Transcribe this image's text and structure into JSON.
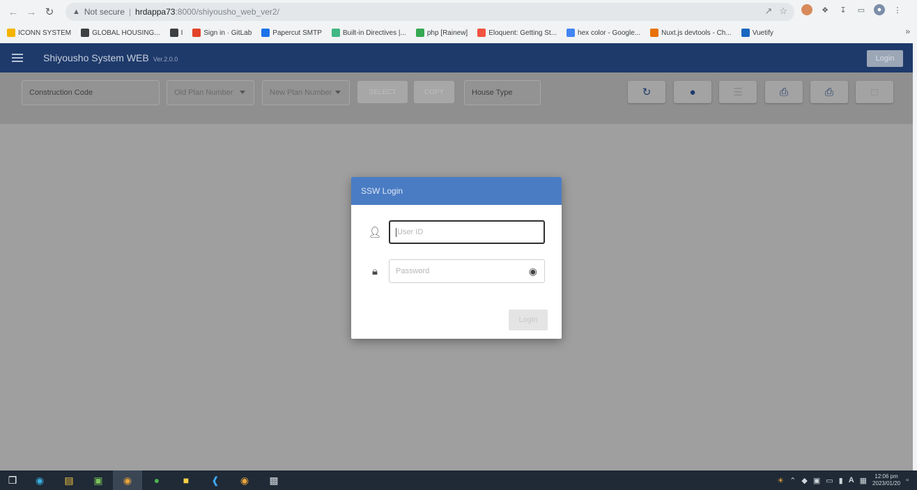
{
  "browser": {
    "security_label": "Not secure",
    "url_host": "hrdappa73",
    "url_path": ":8000/shiyousho_web_ver2/",
    "bookmarks": [
      {
        "label": "ICONN SYSTEM",
        "color": "#f4b400"
      },
      {
        "label": "GLOBAL HOUSING...",
        "color": "#3c4043"
      },
      {
        "label": "I",
        "color": "#3c4043"
      },
      {
        "label": "Sign in · GitLab",
        "color": "#e24329"
      },
      {
        "label": "Papercut SMTP",
        "color": "#1a73e8"
      },
      {
        "label": "Built-in Directives |...",
        "color": "#41b883"
      },
      {
        "label": "php [Rainew]",
        "color": "#34a853"
      },
      {
        "label": "Eloquent: Getting St...",
        "color": "#f05340"
      },
      {
        "label": "hex color - Google...",
        "color": "#4285f4"
      },
      {
        "label": "Nuxt.js devtools - Ch...",
        "color": "#e8710a"
      },
      {
        "label": "Vuetify",
        "color": "#1867c0"
      }
    ]
  },
  "app": {
    "title": "Shiyousho System WEB",
    "version": "Ver.2.0.0",
    "header_login": "Login"
  },
  "toolbar": {
    "construction_code": "Construction Code",
    "old_plan": "Old Plan Number",
    "new_plan": "New Plan Number",
    "btn_select": "SELECT",
    "btn_copy": "COPY",
    "house_type": "House Type"
  },
  "dialog": {
    "title": "SSW Login",
    "user_placeholder": "User ID",
    "password_placeholder": "Password",
    "login_button": "Login"
  },
  "taskbar": {
    "time": "12:06 pm",
    "date": "2023/01/20"
  },
  "colors": {
    "header": "#1e3a6b",
    "dialog_header": "#4a7cc4",
    "overlay": "#9f9f9f"
  }
}
